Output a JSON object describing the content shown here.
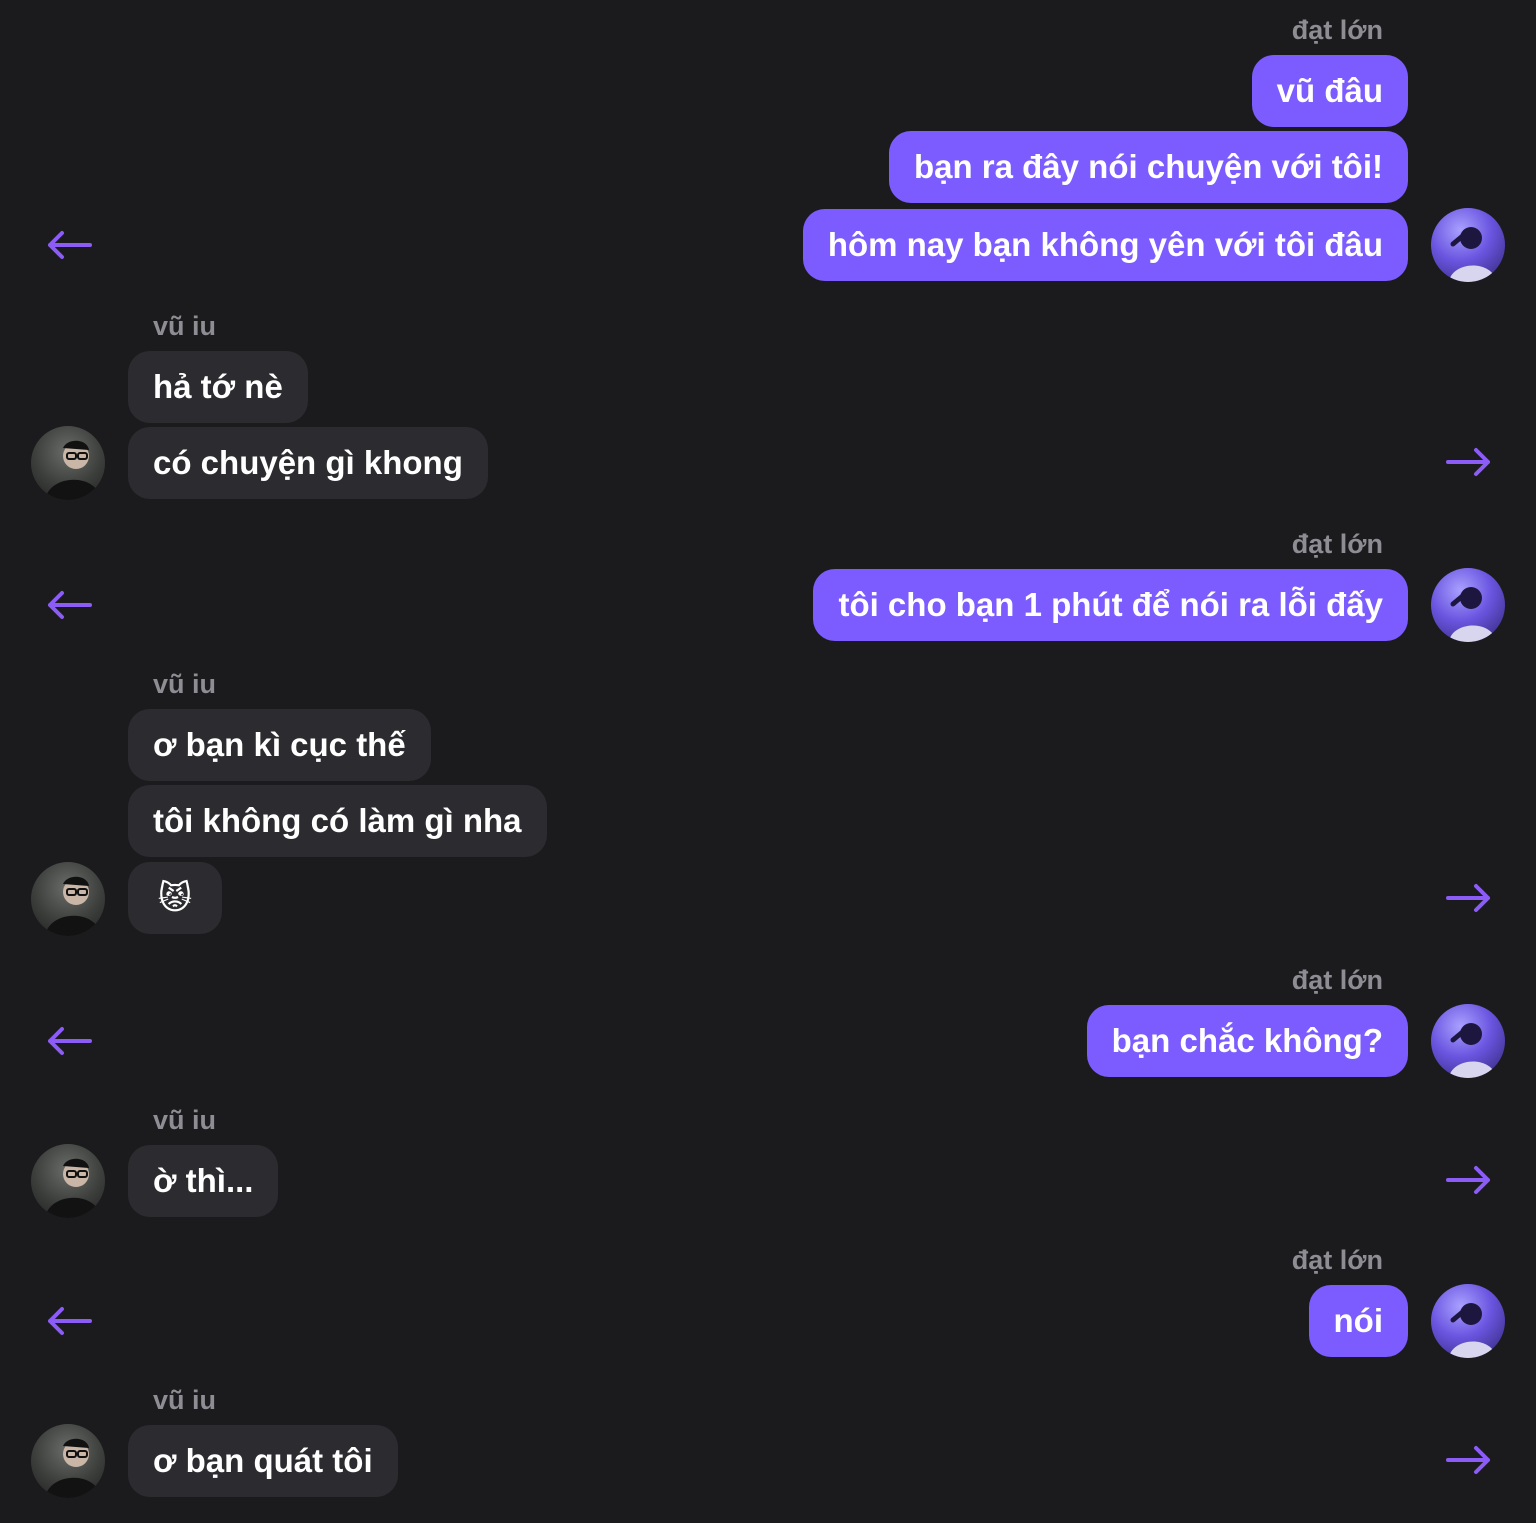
{
  "conversation": {
    "accent_color": "#7c5cff",
    "incoming_bubble_color": "#2c2c30",
    "background_color": "#1b1b1e",
    "blocks": [
      {
        "sender": "đạt lớn",
        "messages": [
          "vũ đâu",
          "bạn ra đây nói chuyện với tôi!",
          "hôm nay bạn không yên với tôi đâu"
        ]
      },
      {
        "sender": "vũ iu",
        "messages": [
          "hả tớ nè",
          "có chuyện gì khong"
        ]
      },
      {
        "sender": "đạt lớn",
        "messages": [
          "tôi cho bạn 1 phút để nói ra lỗi đấy"
        ]
      },
      {
        "sender": "vũ iu",
        "messages": [
          "ơ bạn kì cục thế",
          "tôi không có làm gì nha",
          "😾"
        ]
      },
      {
        "sender": "đạt lớn",
        "messages": [
          "bạn chắc không?"
        ]
      },
      {
        "sender": "vũ iu",
        "messages": [
          "ờ thì..."
        ]
      },
      {
        "sender": "đạt lớn",
        "messages": [
          "nói"
        ]
      },
      {
        "sender": "vũ iu",
        "messages": [
          "ơ bạn quát tôi"
        ]
      }
    ]
  },
  "icons": {
    "outgoing_side_icon": "arrow-left-icon",
    "incoming_side_icon": "arrow-right-icon"
  }
}
